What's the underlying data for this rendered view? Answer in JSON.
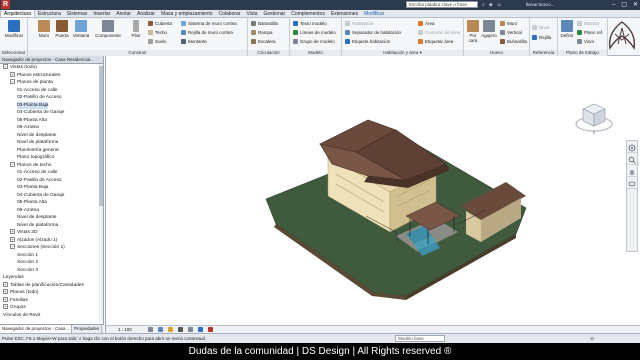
{
  "titlebar": {
    "logo": "R",
    "search_placeholder": "Escriba palabra clave o frase",
    "user": "lluivar.teocio...",
    "controls": [
      "–",
      "▢",
      "✕"
    ]
  },
  "ribbon": {
    "tabs": [
      "Arquitectura",
      "Estructura",
      "Sistemas",
      "Insertar",
      "Anotar",
      "Analizar",
      "Masa y emplazamiento",
      "Colaborar",
      "Vista",
      "Gestionar",
      "Complementos",
      "Extensiones",
      "Modificar"
    ],
    "active_tab": "Arquitectura",
    "modify": {
      "label": "Modificar",
      "group": "Seleccionar ▾"
    },
    "build": {
      "big": [
        "Muro",
        "Puerta",
        "Ventana",
        "Componente",
        "Pilar"
      ],
      "small": [
        "Cubierta",
        "Techo",
        "Suelo",
        "Sistema de muro cortina",
        "Rejilla de muro cortina",
        "Montante"
      ],
      "label": "Construir"
    },
    "circulation": {
      "items": [
        "Barandilla",
        "Rampa",
        "Escalera"
      ],
      "label": "Circulación"
    },
    "model": {
      "items": [
        "Texto modelo",
        "Líneas de modelo",
        "Grupo de modelo"
      ],
      "label": "Modelo"
    },
    "room": {
      "items": [
        "Habitación",
        "Separador de habitación",
        "Etiqueta habitación",
        "Área",
        "Contorno de área",
        "Etiquetar área"
      ],
      "label": "Habitación y área ▾"
    },
    "opening": {
      "big": [
        "Por cara",
        "Agujero"
      ],
      "small": [
        "Muro",
        "Vertical",
        "Buhardilla"
      ],
      "label": "Hueco"
    },
    "datum": {
      "small": [
        "Nivel",
        "Rejilla"
      ],
      "label": "Referencia"
    },
    "workplane": {
      "big": [
        "Definir"
      ],
      "small": [
        "Mostrar",
        "Plano ref.",
        "Visor"
      ],
      "label": "Plano de trabajo"
    }
  },
  "browser": {
    "title": "Navegador de proyectos - Casa Residencial...",
    "items": [
      {
        "text": "Vistas (todo)",
        "toggle": "−",
        "sel": false
      },
      {
        "text": "Planos estructurales",
        "toggle": "+",
        "sel": false
      },
      {
        "text": "Planos de planta",
        "toggle": "−",
        "sel": false
      },
      {
        "text": "01-Acceso de calle",
        "toggle": "",
        "sel": false
      },
      {
        "text": "02-Pasillo de Acceso",
        "toggle": "",
        "sel": false
      },
      {
        "text": "03-Planta Baja",
        "toggle": "",
        "sel": true
      },
      {
        "text": "04-Cubierta de Garaje",
        "toggle": "",
        "sel": false
      },
      {
        "text": "05-Planta Alta",
        "toggle": "",
        "sel": false
      },
      {
        "text": "06-Azotea",
        "toggle": "",
        "sel": false
      },
      {
        "text": "Nivel de desplante",
        "toggle": "",
        "sel": false
      },
      {
        "text": "Nivel de plataforma",
        "toggle": "",
        "sel": false
      },
      {
        "text": "Planimetría general",
        "toggle": "",
        "sel": false
      },
      {
        "text": "Plano topográfico",
        "toggle": "",
        "sel": false
      },
      {
        "text": "Planos de techo",
        "toggle": "−",
        "sel": false
      },
      {
        "text": "01-Acceso de calle",
        "toggle": "",
        "sel": false
      },
      {
        "text": "02-Pasillo de Acceso",
        "toggle": "",
        "sel": false
      },
      {
        "text": "03-Planta Baja",
        "toggle": "",
        "sel": false
      },
      {
        "text": "04-Cubierta de Garaje",
        "toggle": "",
        "sel": false
      },
      {
        "text": "05-Planta Alta",
        "toggle": "",
        "sel": false
      },
      {
        "text": "06-Azotea",
        "toggle": "",
        "sel": false
      },
      {
        "text": "Nivel de desplante",
        "toggle": "",
        "sel": false
      },
      {
        "text": "Nivel de plataforma",
        "toggle": "",
        "sel": false
      },
      {
        "text": "Vistas 3D",
        "toggle": "+",
        "sel": false
      },
      {
        "text": "Alzados (Alzado 1)",
        "toggle": "+",
        "sel": false
      },
      {
        "text": "Secciones (Sección 1)",
        "toggle": "−",
        "sel": false
      },
      {
        "text": "Sección 1",
        "toggle": "",
        "sel": false
      },
      {
        "text": "Sección 2",
        "toggle": "",
        "sel": false
      },
      {
        "text": "Sección 3",
        "toggle": "",
        "sel": false
      },
      {
        "text": "Leyendas",
        "toggle": "",
        "sel": false
      },
      {
        "text": "Tablas de planificación/Cantidades",
        "toggle": "+",
        "sel": false
      },
      {
        "text": "Planos (todo)",
        "toggle": "+",
        "sel": false
      },
      {
        "text": "Familias",
        "toggle": "+",
        "sel": false
      },
      {
        "text": "Grupos",
        "toggle": "+",
        "sel": false
      },
      {
        "text": "Vínculos de Revit",
        "toggle": "",
        "sel": false
      }
    ],
    "tabs": [
      "Navegador de proyectos - Casa ...",
      "Propiedades"
    ]
  },
  "viewport": {
    "scale": "1 : 100",
    "viewcube_label": "S"
  },
  "statusbar": {
    "text": "Pulse ESC, F8 o Mayús+W para salir; o haga clic con el botón derecho para abrir un menú contextual.",
    "model_field": "Modelo base",
    "filter_count": ":0"
  },
  "footer": {
    "text": "Dudas de la comunidad | DS Design | All Rights reserved ®"
  },
  "colors": {
    "terrain": "#3f5a3c",
    "roof": "#6a4a3a",
    "wall": "#e8d7a8",
    "titlebar": "#2b3a4d"
  }
}
